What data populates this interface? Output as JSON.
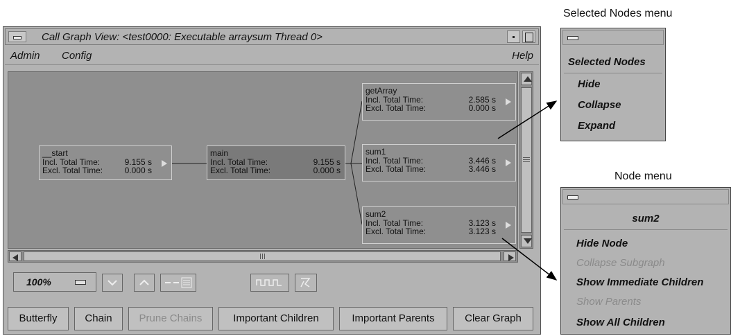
{
  "window": {
    "title": "Call Graph View: <test0000: Executable arraysum Thread 0>",
    "menus": [
      "Admin",
      "Config"
    ],
    "help": "Help"
  },
  "graph": {
    "labels": {
      "incl": "Incl. Total Time:",
      "excl": "Excl. Total Time:"
    },
    "nodes": [
      {
        "name": "__start",
        "incl": "9.155 s",
        "excl": "0.000 s"
      },
      {
        "name": "main",
        "incl": "9.155 s",
        "excl": "0.000 s"
      },
      {
        "name": "getArray",
        "incl": "2.585 s",
        "excl": "0.000 s"
      },
      {
        "name": "sum1",
        "incl": "3.446 s",
        "excl": "3.446 s"
      },
      {
        "name": "sum2",
        "incl": "3.123 s",
        "excl": "3.123 s"
      }
    ]
  },
  "toolbar": {
    "zoom": "100%"
  },
  "buttons": [
    {
      "label": "Butterfly",
      "disabled": false
    },
    {
      "label": "Chain",
      "disabled": false
    },
    {
      "label": "Prune Chains",
      "disabled": true
    },
    {
      "label": "Important Children",
      "disabled": false
    },
    {
      "label": "Important Parents",
      "disabled": false
    },
    {
      "label": "Clear Graph",
      "disabled": false
    }
  ],
  "selected_nodes_menu": {
    "caption": "Selected Nodes menu",
    "title": "Selected Nodes",
    "items": [
      "Hide",
      "Collapse",
      "Expand"
    ]
  },
  "node_menu": {
    "caption": "Node menu",
    "title": "sum2",
    "items": [
      {
        "label": "Hide Node",
        "disabled": false
      },
      {
        "label": "Collapse Subgraph",
        "disabled": true
      },
      {
        "label": "Show Immediate Children",
        "disabled": false
      },
      {
        "label": "Show Parents",
        "disabled": true
      },
      {
        "label": "Show All Children",
        "disabled": false
      }
    ]
  }
}
